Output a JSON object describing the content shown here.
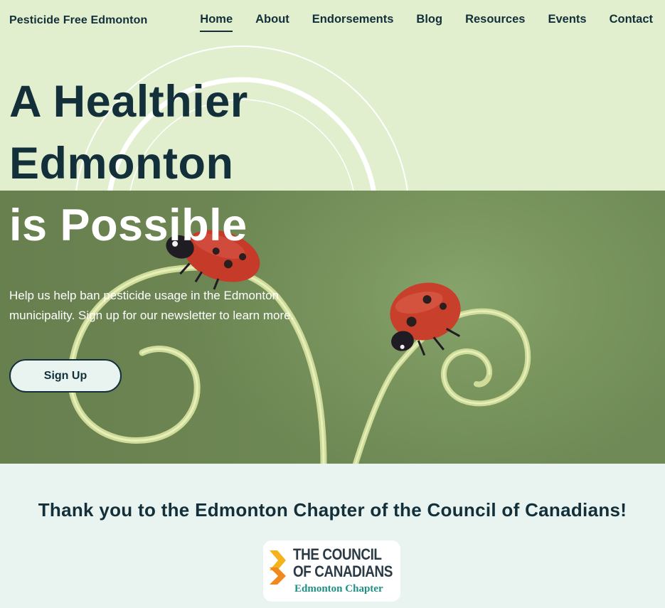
{
  "nav": {
    "brand": "Pesticide Free Edmonton",
    "items": [
      {
        "label": "Home",
        "active": true
      },
      {
        "label": "About",
        "active": false
      },
      {
        "label": "Endorsements",
        "active": false
      },
      {
        "label": "Blog",
        "active": false
      },
      {
        "label": "Resources",
        "active": false
      },
      {
        "label": "Events",
        "active": false
      },
      {
        "label": "Contact",
        "active": false
      }
    ]
  },
  "hero": {
    "headline_line1": "A Healthier",
    "headline_line2": "Edmonton",
    "headline_line3": "is Possible",
    "blurb": "Help us help ban pesticide usage in the Edmonton municipality. Sign up for our newsletter to learn more.",
    "cta_label": "Sign Up"
  },
  "thanks": {
    "title": "Thank you to the Edmonton Chapter of the Council of Canadians!",
    "logo": {
      "line1": "THE COUNCIL",
      "line2": "OF CANADIANS",
      "subline": "Edmonton Chapter"
    }
  },
  "colors": {
    "text_dark": "#13303a",
    "hero_light": "#e1efcf",
    "section_bg": "#e9f3ef",
    "logo_teal": "#1f8f84",
    "logo_orange": "#f39c1f",
    "ladybug_red": "#c0392b"
  }
}
